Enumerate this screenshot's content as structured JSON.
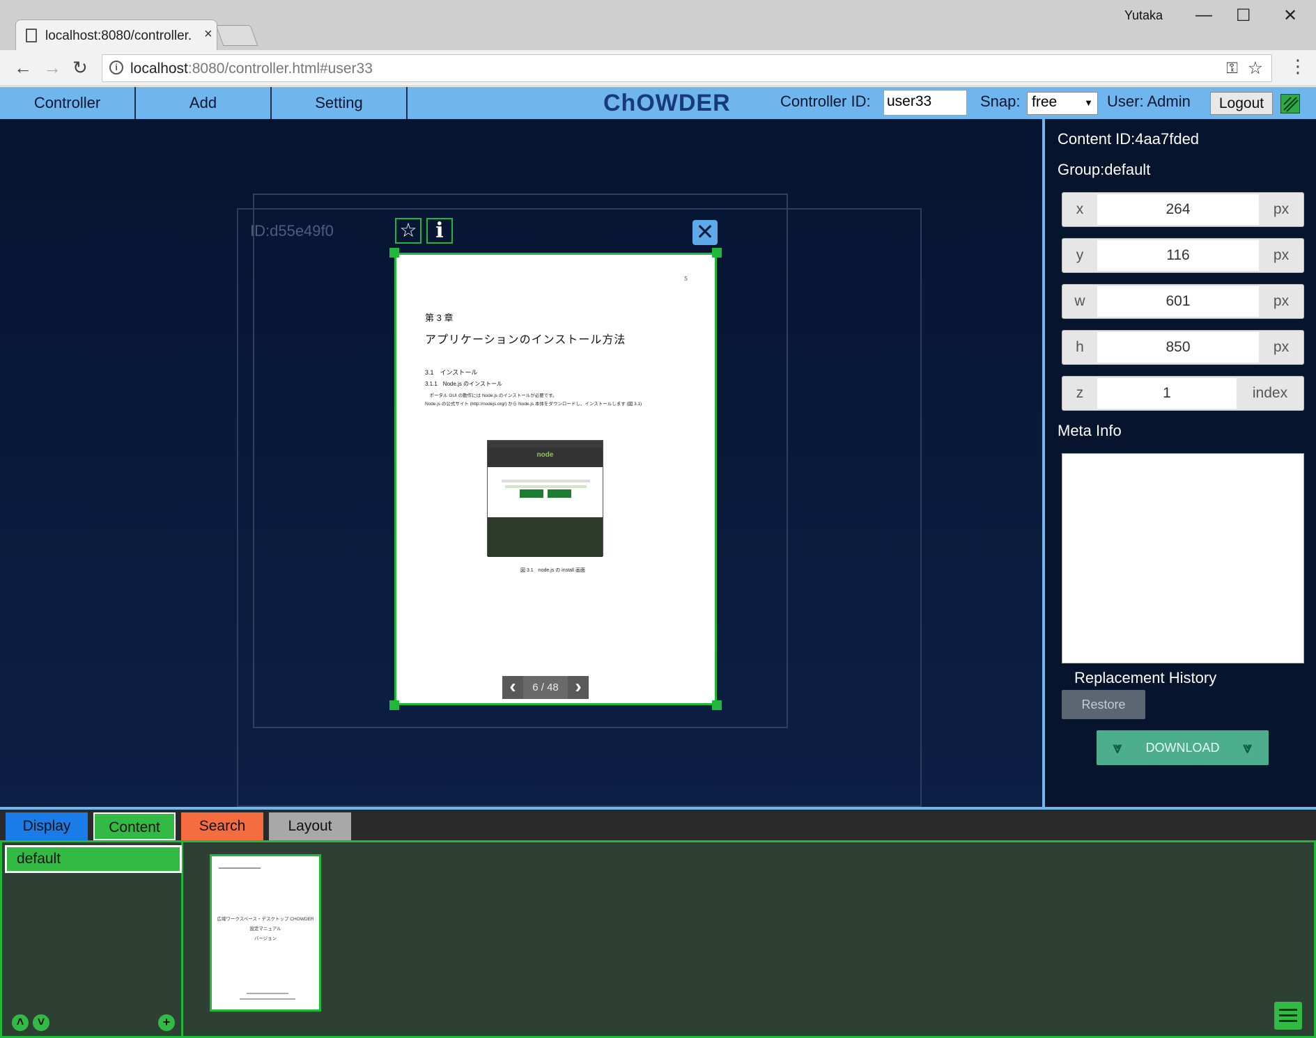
{
  "browser": {
    "tab_title": "localhost:8080/controller.html#user33",
    "tab_close": "×",
    "window_user": "Yutaka",
    "win_minimize": "—",
    "win_maximize": "☐",
    "win_close": "✕",
    "back": "←",
    "forward": "→",
    "reload": "↻",
    "url_host": "localhost",
    "url_rest": ":8080/controller.html#user33",
    "key_icon": "⚿",
    "star_icon": "☆",
    "menu_icon": "⋮"
  },
  "header": {
    "menus": [
      "Controller",
      "Add",
      "Setting"
    ],
    "title": "ChOWDER",
    "controller_id_label": "Controller ID:",
    "controller_id_value": "user33",
    "snap_label": "Snap:",
    "snap_value": "free",
    "user_label": "User: Admin",
    "logout": "Logout"
  },
  "canvas": {
    "display_id": "ID:d55e49f0",
    "star_glyph": "☆",
    "info_glyph": "i",
    "close_glyph": "✕",
    "document": {
      "page_number": "5",
      "chapter": "第 3 章",
      "heading": "アプリケーションのインストール方法",
      "section": "3.1　インストール",
      "subsection": "3.1.1　Node.js のインストール",
      "para1": "　ポータル GUI の動作には Node.js のインストールが必要です。",
      "para2": "Node.js の公式サイト (http://nodejs.org/) から Node.js 本体をダウンロードし、インストールします (図 3.1)",
      "screenshot_logo": "node",
      "caption": "図 3.1　node.js の install 画面"
    },
    "pager": {
      "prev": "‹",
      "text": "6 / 48",
      "next": "›"
    }
  },
  "properties": {
    "content_id": "Content ID:4aa7fded",
    "group": "Group:default",
    "fields": [
      {
        "label": "x",
        "value": "264",
        "unit": "px"
      },
      {
        "label": "y",
        "value": "116",
        "unit": "px"
      },
      {
        "label": "w",
        "value": "601",
        "unit": "px"
      },
      {
        "label": "h",
        "value": "850",
        "unit": "px"
      },
      {
        "label": "z",
        "value": "1",
        "unit": "index"
      }
    ],
    "meta_info_label": "Meta Info",
    "replacement_history_label": "Replacement History",
    "restore": "Restore",
    "download": "DOWNLOAD",
    "download_chevron": "⩔"
  },
  "bottom": {
    "tabs": [
      {
        "label": "Display",
        "color": "#1a7ce8"
      },
      {
        "label": "Content",
        "color": "#33ba44"
      },
      {
        "label": "Search",
        "color": "#f56c3f"
      },
      {
        "label": "Layout",
        "color": "#a8a8a8"
      }
    ],
    "group_name": "default",
    "up_glyph": "˄",
    "down_glyph": "˅",
    "add_glyph": "+",
    "thumbnail": {
      "line1": "広域ワークスペース・デスクトップ CHOWDER",
      "line2": "設定マニュアル",
      "line3": "バージョン"
    }
  },
  "colors": {
    "header_bg": "#6fb5ee",
    "accent_green": "#1fb838",
    "canvas_bg": "#061430",
    "download_bg": "#4dae8d"
  }
}
